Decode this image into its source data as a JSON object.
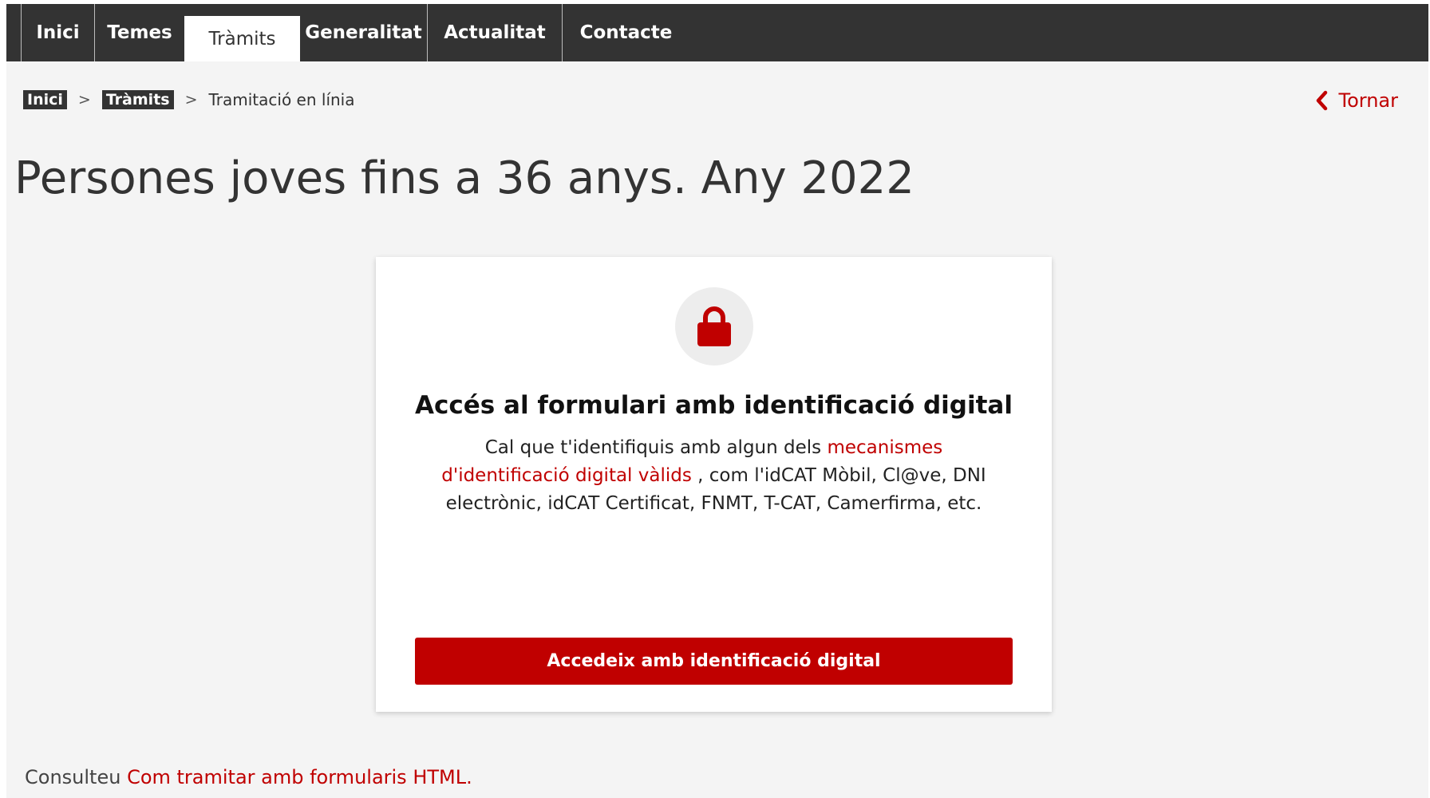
{
  "nav": {
    "tabs": [
      {
        "label": "Inici"
      },
      {
        "label": "Temes"
      },
      {
        "label": "Tràmits",
        "active": true
      },
      {
        "label": "Generalitat"
      },
      {
        "label": "Actualitat"
      },
      {
        "label": "Contacte"
      }
    ]
  },
  "breadcrumb": {
    "items": [
      "Inici",
      "Tràmits"
    ],
    "separator": ">",
    "current": "Tramitació en línia"
  },
  "back": {
    "label": "Tornar",
    "icon": "chevron-left-icon"
  },
  "page": {
    "title": "Persones joves fins a 36 anys. Any 2022"
  },
  "card": {
    "icon": "lock-icon",
    "heading": "Accés al formulari amb identificació digital",
    "text_before": "Cal que t'identifiquis amb algun dels ",
    "text_link": "mecanismes d'identificació digital vàlids",
    "text_after": " , com l'idCAT Mòbil, Cl@ve, DNI electrònic, idCAT Certificat, FNMT, T-CAT, Camerfirma, etc.",
    "button_label": "Accedeix amb identificació digital"
  },
  "footer": {
    "prefix": "Consulteu ",
    "link": "Com tramitar amb formularis HTML."
  },
  "colors": {
    "accent": "#c00000",
    "nav_bg": "#333333",
    "page_bg": "#f4f4f4"
  }
}
